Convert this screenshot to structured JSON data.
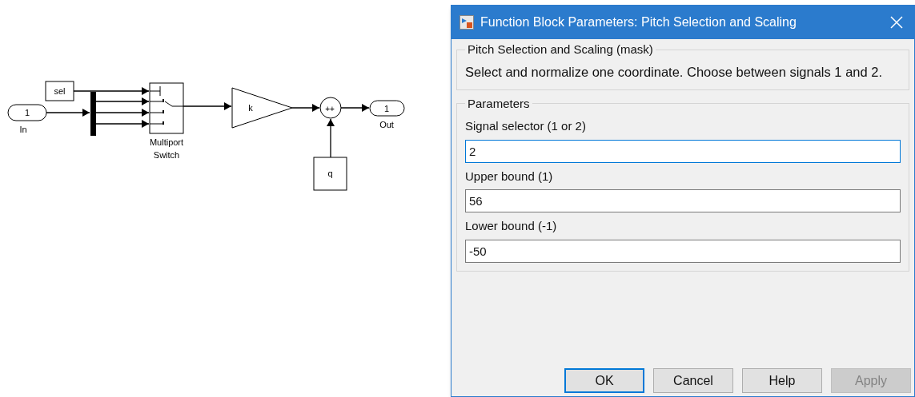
{
  "diagram": {
    "blocks": [
      {
        "kind": "inport",
        "label": "1",
        "caption": "In"
      },
      {
        "kind": "constant",
        "label": "sel"
      },
      {
        "kind": "mux"
      },
      {
        "kind": "switch",
        "caption": [
          "Multiport",
          "Switch"
        ]
      },
      {
        "kind": "gain",
        "label": "k"
      },
      {
        "kind": "sum",
        "label": "++"
      },
      {
        "kind": "outport",
        "label": "1",
        "caption": "Out"
      },
      {
        "kind": "constant2",
        "label": "q"
      }
    ]
  },
  "dialog": {
    "title": "Function Block Parameters: Pitch Selection and Scaling",
    "mask": {
      "title": "Pitch Selection and Scaling (mask)",
      "description": "Select and normalize one coordinate. Choose between signals 1 and 2."
    },
    "parameters": {
      "title": "Parameters",
      "fields": [
        {
          "label": "Signal selector (1 or 2)",
          "value": "2",
          "focused": true
        },
        {
          "label": "Upper bound (1)",
          "value": "56",
          "focused": false
        },
        {
          "label": "Lower bound (-1)",
          "value": "-50",
          "focused": false
        }
      ]
    },
    "buttons": [
      {
        "label": "OK",
        "default": true,
        "disabled": false
      },
      {
        "label": "Cancel",
        "default": false,
        "disabled": false
      },
      {
        "label": "Help",
        "default": false,
        "disabled": false
      },
      {
        "label": "Apply",
        "default": false,
        "disabled": true
      }
    ]
  }
}
